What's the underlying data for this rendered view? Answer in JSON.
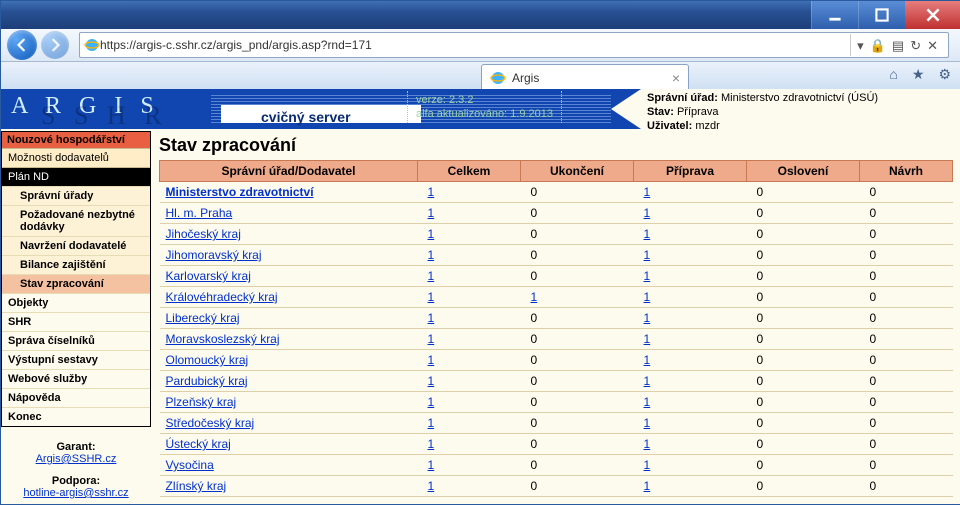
{
  "browser": {
    "url": "https://argis-c.sshr.cz/argis_pnd/argis.asp?rnd=171",
    "tab_title": "Argis"
  },
  "banner": {
    "logo": "A R G I S",
    "subtitle": "cvičný server",
    "version_line1": "verze: 2.3.2",
    "version_line2": "alfa aktualizováno: 1.9.2013",
    "info_office_label": "Správní úřad:",
    "info_office_value": "Ministerstvo zdravotnictví (ÚSÚ)",
    "info_state_label": "Stav:",
    "info_state_value": "Příprava",
    "info_user_label": "Uživatel:",
    "info_user_value": "mzdr"
  },
  "sidebar": {
    "section_title": "Nouzové hospodářství",
    "item_moznosti": "Možnosti dodavatelů",
    "item_plan": "Plán ND",
    "sub_spravni": "Správní úřady",
    "sub_pozad": "Požadované nezbytné dodávky",
    "sub_navrz": "Navržení dodavatelé",
    "sub_bilance": "Bilance zajištění",
    "sub_stav": "Stav zpracování",
    "plain_objekty": "Objekty",
    "plain_shr": "SHR",
    "plain_sprava": "Správa číselníků",
    "plain_vystup": "Výstupní sestavy",
    "plain_web": "Webové služby",
    "plain_napoveda": "Nápověda",
    "plain_konec": "Konec",
    "garant_label": "Garant:",
    "garant_link": "Argis@SSHR.cz",
    "podpora_label": "Podpora:",
    "podpora_link": "hotline-argis@sshr.cz"
  },
  "content": {
    "title": "Stav zpracování",
    "headers": {
      "col1": "Správní úřad/Dodavatel",
      "col2": "Celkem",
      "col3": "Ukončení",
      "col4": "Příprava",
      "col5": "Oslovení",
      "col6": "Návrh"
    },
    "rows": [
      {
        "name": "Ministerstvo zdravotnictví",
        "indent": 0,
        "celkem": "1",
        "ukon": "0",
        "prip": "1",
        "osl": "0",
        "navrh": "0"
      },
      {
        "name": "Hl. m. Praha",
        "indent": 1,
        "celkem": "1",
        "ukon": "0",
        "prip": "1",
        "osl": "0",
        "navrh": "0"
      },
      {
        "name": "Jihočeský kraj",
        "indent": 1,
        "celkem": "1",
        "ukon": "0",
        "prip": "1",
        "osl": "0",
        "navrh": "0"
      },
      {
        "name": "Jihomoravský kraj",
        "indent": 1,
        "celkem": "1",
        "ukon": "0",
        "prip": "1",
        "osl": "0",
        "navrh": "0"
      },
      {
        "name": "Karlovarský kraj",
        "indent": 1,
        "celkem": "1",
        "ukon": "0",
        "prip": "1",
        "osl": "0",
        "navrh": "0"
      },
      {
        "name": "Královéhradecký kraj",
        "indent": 1,
        "celkem": "1",
        "ukon": "1",
        "prip": "1",
        "osl": "0",
        "navrh": "0"
      },
      {
        "name": "Liberecký kraj",
        "indent": 1,
        "celkem": "1",
        "ukon": "0",
        "prip": "1",
        "osl": "0",
        "navrh": "0"
      },
      {
        "name": "Moravskoslezský kraj",
        "indent": 1,
        "celkem": "1",
        "ukon": "0",
        "prip": "1",
        "osl": "0",
        "navrh": "0"
      },
      {
        "name": "Olomoucký kraj",
        "indent": 1,
        "celkem": "1",
        "ukon": "0",
        "prip": "1",
        "osl": "0",
        "navrh": "0"
      },
      {
        "name": "Pardubický kraj",
        "indent": 1,
        "celkem": "1",
        "ukon": "0",
        "prip": "1",
        "osl": "0",
        "navrh": "0"
      },
      {
        "name": "Plzeňský kraj",
        "indent": 1,
        "celkem": "1",
        "ukon": "0",
        "prip": "1",
        "osl": "0",
        "navrh": "0"
      },
      {
        "name": "Středočeský kraj",
        "indent": 1,
        "celkem": "1",
        "ukon": "0",
        "prip": "1",
        "osl": "0",
        "navrh": "0"
      },
      {
        "name": "Ústecký kraj",
        "indent": 1,
        "celkem": "1",
        "ukon": "0",
        "prip": "1",
        "osl": "0",
        "navrh": "0"
      },
      {
        "name": "Vysočina",
        "indent": 1,
        "celkem": "1",
        "ukon": "0",
        "prip": "1",
        "osl": "0",
        "navrh": "0"
      },
      {
        "name": "Zlínský kraj",
        "indent": 1,
        "celkem": "1",
        "ukon": "0",
        "prip": "1",
        "osl": "0",
        "navrh": "0"
      }
    ]
  }
}
